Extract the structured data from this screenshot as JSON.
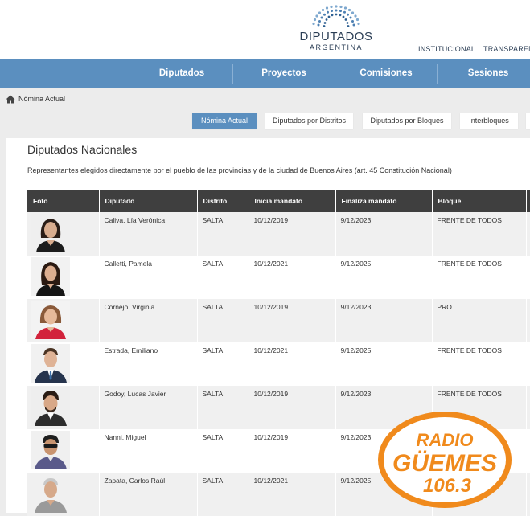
{
  "header": {
    "logo_title": "DIPUTADOS",
    "logo_subtitle": "ARGENTINA",
    "top_links": [
      "INSTITUCIONAL",
      "TRANSPARENC"
    ]
  },
  "nav": {
    "items": [
      "Diputados",
      "Proyectos",
      "Comisiones",
      "Sesiones"
    ]
  },
  "breadcrumb": {
    "label": "Nómina Actual",
    "icon": "home-icon"
  },
  "tabs": [
    "Nómina Actual",
    "Diputados por Distritos",
    "Diputados por Bloques",
    "Interbloques"
  ],
  "tabs_active": "Nómina Actual",
  "main": {
    "title": "Diputados Nacionales",
    "description": "Representantes elegidos directamente por el pueblo de las provincias y de la ciudad de Buenos Aires (art. 45 Constitución Nacional)"
  },
  "table": {
    "headers": [
      "Foto",
      "Diputado",
      "Distrito",
      "Inicia mandato",
      "Finaliza mandato",
      "Bloque"
    ],
    "rows": [
      {
        "name": "Caliva, Lía Verónica",
        "distrito": "SALTA",
        "inicia": "10/12/2019",
        "finaliza": "9/12/2023",
        "bloque": "FRENTE DE TODOS"
      },
      {
        "name": "Calletti, Pamela",
        "distrito": "SALTA",
        "inicia": "10/12/2021",
        "finaliza": "9/12/2025",
        "bloque": "FRENTE DE TODOS"
      },
      {
        "name": "Cornejo, Virginia",
        "distrito": "SALTA",
        "inicia": "10/12/2019",
        "finaliza": "9/12/2023",
        "bloque": "PRO"
      },
      {
        "name": "Estrada, Emiliano",
        "distrito": "SALTA",
        "inicia": "10/12/2021",
        "finaliza": "9/12/2025",
        "bloque": "FRENTE DE TODOS"
      },
      {
        "name": "Godoy, Lucas Javier",
        "distrito": "SALTA",
        "inicia": "10/12/2019",
        "finaliza": "9/12/2023",
        "bloque": "FRENTE DE TODOS"
      },
      {
        "name": "Nanni, Miguel",
        "distrito": "SALTA",
        "inicia": "10/12/2019",
        "finaliza": "9/12/2023",
        "bloque": ""
      },
      {
        "name": "Zapata, Carlos Raúl",
        "distrito": "SALTA",
        "inicia": "10/12/2021",
        "finaliza": "9/12/2025",
        "bloque": ""
      }
    ]
  },
  "watermark": {
    "line1": "RADIO",
    "line2": "GÜEMES",
    "line3": "106.3"
  },
  "colors": {
    "nav_bg": "#5b8fbf",
    "header_text": "#2b3e55",
    "table_header_bg": "#3f3f3f",
    "watermark_orange": "#f08a1c"
  }
}
